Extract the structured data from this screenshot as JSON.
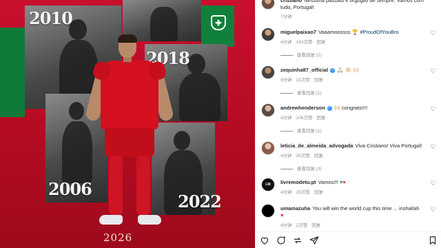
{
  "poster": {
    "years": [
      "2010",
      "2018",
      "2006",
      "2022"
    ],
    "bottom_year": "2026",
    "colors": {
      "red": "#c8102e",
      "green": "#0f7a3a"
    }
  },
  "comments": [
    {
      "user": "cristiano",
      "text": "Nessuna passato e orgoglio de sempre. Vamos com tudo, Portugal!",
      "time": "7分钟"
    },
    {
      "user": "miguelpaixao7",
      "verified": false,
      "text": "Vaaamoossss",
      "hashtag": "#ProudOfYouBro",
      "time": "4分钟",
      "likes": "143次赞",
      "reply": "回复",
      "view_replies": "查看回复 (2)"
    },
    {
      "user": "zequinha87_official",
      "verified": true,
      "text": "🙏🏻 👏🏻 🙌🏻",
      "time": "4分钟",
      "likes": "15次赞",
      "reply": "回复",
      "view_replies": "查看回复 (1)"
    },
    {
      "user": "andrewhenderson",
      "verified": true,
      "text": "congrats!!!!",
      "time": "4分钟",
      "likes": "106次赞",
      "reply": "回复",
      "view_replies": "查看回复 (1)"
    },
    {
      "user": "leticia_de_almeida_advogada",
      "verified": false,
      "text": "Viva Cristiano! Viva Portugal!",
      "time": "4分钟",
      "likes": "35次赞",
      "reply": "回复",
      "view_replies": "查看回复 (3)"
    },
    {
      "user": "livremodetu.pt",
      "verified": false,
      "text": "Vamos!!!",
      "time": "4分钟",
      "likes": "28次赞",
      "reply": "回复"
    },
    {
      "user": "umamazuha",
      "verified": false,
      "text": "You will win the world cup this time ... inshallah",
      "time": "4分钟",
      "likes": "2次赞",
      "reply": "回复"
    }
  ],
  "actions": {
    "icons": [
      "heart-icon",
      "comment-icon",
      "share-icon",
      "send-icon",
      "bookmark-icon"
    ]
  }
}
